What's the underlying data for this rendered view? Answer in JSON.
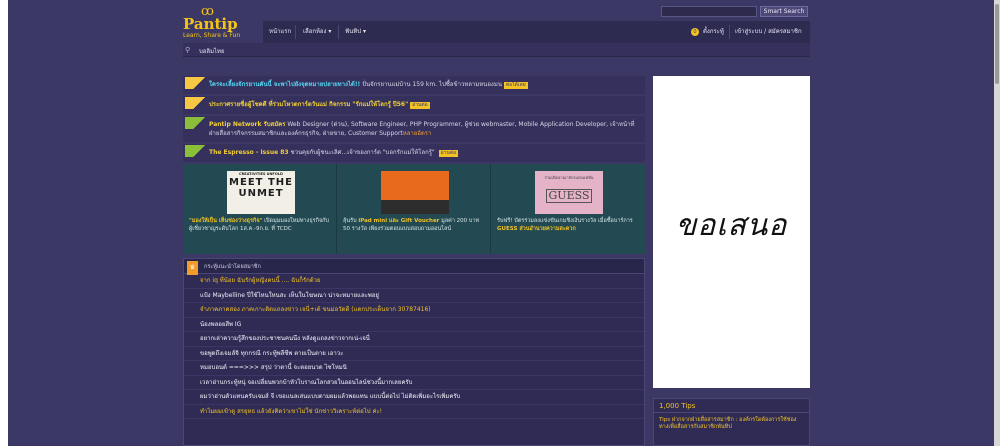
{
  "header": {
    "logo_glyph": "ꝏ",
    "logo_name": "Pantip",
    "logo_tag": "Learn, Share & Fun",
    "search_placeholder": "",
    "search_button": "Smart Search"
  },
  "nav": {
    "items": [
      {
        "label": "หน้าแรก"
      },
      {
        "label": "เลือกห้อง ▾"
      },
      {
        "label": "ฟันทิป ▾"
      }
    ],
    "right": {
      "notify_badge": "0",
      "settings": "ตั้งกระทู้",
      "login": "เข้าสู่ระบบ / สมัครสมาชิก"
    }
  },
  "breadcrumb": {
    "pin": "⚲",
    "label": "บอลิมไทย"
  },
  "announcements": [
    {
      "ribbon": "yellow",
      "lead": "ใครจะเลี้ยงจักรยานคันนี้ จะพาไปยังจุดหมายปลายทางได้!!",
      "body": " ปั่นจักรยานแม่บ้าน 159 km. ไปซื้อข้าวหลามหนองมน",
      "more": "ต่อได้เลย"
    },
    {
      "ribbon": "yellow",
      "lead": "ประกาศรายชื่อผู้โชคดี ที่ร่วมโหวตการ์ตวันแม่ กิจกรรม \"รักแม่ให้โลกรู้ ปี56\"",
      "body": "",
      "more": "อ่านต่อ"
    },
    {
      "ribbon": "green",
      "lead": "Pantip Network รับสมัคร",
      "body": " Web Designer (ด่วน), Software Engineer, PHP Programmer, ผู้ช่วย webmaster, Mobile Application Developer, เจ้าหน้าที่ฝ่ายสื่อสารกิจกรรมสมาชิกและองค์กรธุรกิจ, ฝ่ายขาย, Customer Support",
      "tail": "หลายอัตรา"
    },
    {
      "ribbon": "green",
      "lead": "The Espresso - Issue 83",
      "body": " ชวนคุยกับผู้ชนะเลิศ...เจ้าของการ์ด \"บอกรักแม่ให้โลกรู้\" ",
      "more": "อ่านต่อ"
    }
  ],
  "cards": [
    {
      "img_small": "CREATIVITIES UNFOLD",
      "img_big": "MEET THE UNMET",
      "cap_hl": "\"มองให้เป็น เห็นช่องว่างธุรกิจ\"",
      "cap": " เปิดมุมมองใหม่ทางธุรกิจกับผู้เชี่ยวชาญระดับโลก 1ส.ค.-9ก.ย. ที่ TCDC"
    },
    {
      "cap_pre": "ลุ้นรับ ",
      "cap_hl": "iPad mini และ Gift Voucher",
      "cap": " มูลค่า 200 บาท 50 รางวัล เพียงร่วมตอบแบบสอบถามออนไลน์"
    },
    {
      "img_small": "ร่วมเปิดอาณาจักรแห่งแฟชั่น",
      "img_big": "GUESS",
      "cap_pre": "รับฟรี! บัตรร่วมลงแข่งขันเกมชิงเงินรางวัล เมื่อซื้อบาร์การ ",
      "cap_hl": "GUESS ส่วนอำนวยความสะดวก",
      "cap": ""
    }
  ],
  "recommended": {
    "trophy_icon": "♛",
    "title": "กระทู้แนะนำโดยสมาชิก",
    "items": [
      {
        "text": "จาก iq ที่น้อย ฉันรักผู้หญิงคนนี้ .... ฉันก็รักด้วย",
        "color": "orange"
      },
      {
        "text": "แป้ง Maybelline ปี่ใช้ไหนใหนสะ เห็นในโฆษณา น่าจะหมายและพอยู่",
        "color": "white"
      },
      {
        "text": "จำภาคภาคสอง ภาคเกาะติดแถลงข่าว เจนี่+เต้ ขนม่อวัดดี (แตกประเด็นจาก 30787416)",
        "color": "orange"
      },
      {
        "text": "น้องพลอยสีพ IG",
        "color": "white"
      },
      {
        "text": "อยากเล่าความรู้สึกของประชาชนคนนึง หลังดูแถลงข่าวจากเน่-เจนี่",
        "color": "white"
      },
      {
        "text": "ขอพูดถึงเจมส์จิ ทุกกรณี กระทู้พลีชีพ ตายเป็นตาย เอาวะ",
        "color": "white"
      },
      {
        "text": "หมอบอนด์ ===>>> สรุป ว่าตานี้ จะตอยนวด ไซโหมนิ",
        "color": "white"
      },
      {
        "text": "เวลาอ่านกระทู้หนุ่ จอเปลี่ยนพวกบ้าหัวโบราณโลกสวยในออนไลน์ช่วงนี้มากเลยครับ",
        "color": "white"
      },
      {
        "text": "ผมว่าอ่านตัวแทนครับเจมส์ จี เขอแนลเล่นแบบตามผมแล้วพอแทน แบบนี้ต่อไป ไม่ติดเพิ่มอะไรเพิ่มครับ",
        "color": "white"
      },
      {
        "text": "ทำไมผมเข้าดู สรยุทธ แล้วยังคิดว่าเขาไม่ใช่ นักข่าววิเคราะห์ต่อไป ค่ะ!",
        "color": "orange"
      }
    ]
  },
  "ad": {
    "text": "ขอเสนอ"
  },
  "tips": {
    "title": "1,000 Tips",
    "lead": "Tips",
    "body": " ฝากจากฝ่ายสื่อสารสมาชิก : องค์กรใดต้องการใช้ช่องทางเพื่อสื่อสารกับสมาชิกพันทิป"
  },
  "colors": {
    "background": "#3c3865",
    "nav": "#2e2b51",
    "accent": "#f2c225",
    "cyan": "#56d4f0",
    "orange": "#f29c2c",
    "card_bg": "#234a52"
  }
}
